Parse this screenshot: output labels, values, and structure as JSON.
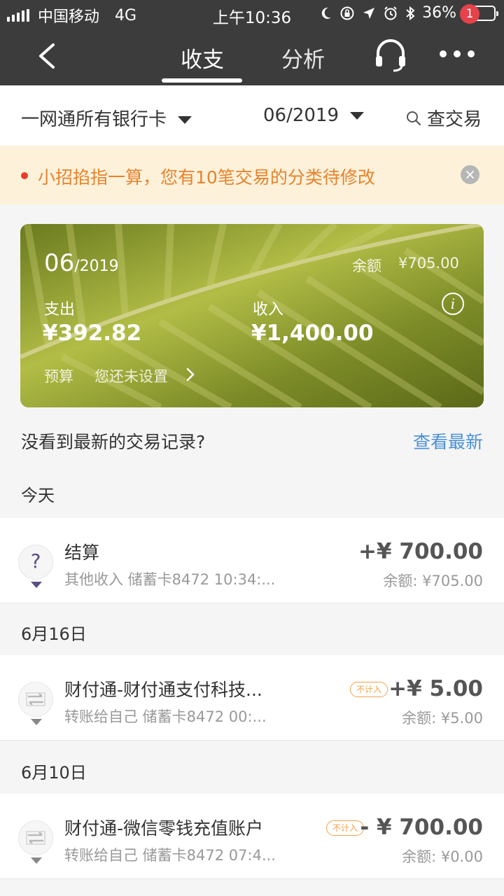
{
  "status_bar": {
    "carrier": "中国移动",
    "network": "4G",
    "time": "上午10:36",
    "battery_percent": "36%",
    "battery_level": 0.36
  },
  "nav": {
    "tab_active": "收支",
    "tab_other": "分析",
    "badge_count": "1"
  },
  "filter": {
    "cards": "一网通所有银行卡",
    "month": "06/2019",
    "search": "查交易"
  },
  "notice": {
    "text": "小招掐指一算，您有10笔交易的分类待修改",
    "close": "×"
  },
  "summary": {
    "period_month": "06",
    "period_year": "/2019",
    "balance_label": "余额",
    "balance_value": "¥705.00",
    "expense_label": "支出",
    "expense_value": "¥392.82",
    "income_label": "收入",
    "income_value": "¥1,400.00",
    "info": "i",
    "budget_label": "预算",
    "budget_value": "您还未设置"
  },
  "latest": {
    "question": "没看到最新的交易记录?",
    "link": "查看最新"
  },
  "sections": [
    {
      "date": "今天",
      "item": {
        "icon": "question-icon",
        "title": "结算",
        "sub": "其他收入  储蓄卡8472 10:34:...",
        "amount": "+¥ 700.00",
        "balance": "余额: ¥705.00"
      }
    },
    {
      "date": "6月16日",
      "item": {
        "icon": "transfer-icon",
        "title": "财付通-财付通支付科技...",
        "tag": "不计入",
        "sub": "转账给自己  储蓄卡8472 00:...",
        "amount": "+¥ 5.00",
        "balance": "余额: ¥5.00"
      }
    },
    {
      "date": "6月10日",
      "item": {
        "icon": "transfer-icon",
        "title": "财付通-微信零钱充值账户",
        "tag": "不计入",
        "sub": "转账给自己  储蓄卡8472 07:4...",
        "amount": "- ¥ 700.00",
        "balance": "余额: ¥0.00"
      }
    }
  ]
}
